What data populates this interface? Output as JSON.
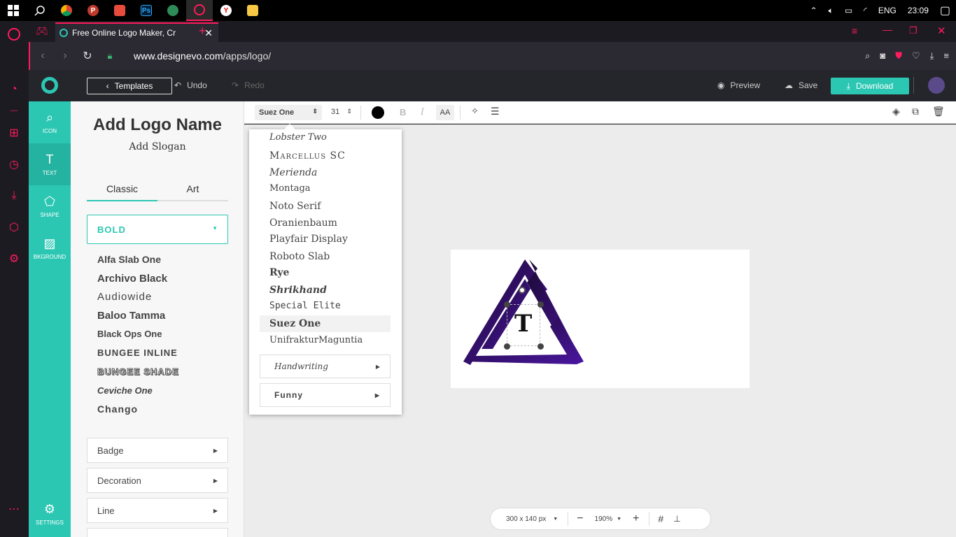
{
  "taskbar": {
    "apps": [
      "chrome",
      "app-p",
      "app-bird",
      "photoshop",
      "app-tree",
      "opera",
      "yandex",
      "explorer"
    ],
    "lang": "ENG",
    "time": "23:09",
    "app_p_label": "P",
    "ps_label": "Ps",
    "yandex_label": "Y"
  },
  "browser": {
    "tab_title": "Free Online Logo Maker, Cr",
    "url_host": "www.designevo.com",
    "url_path": "/apps/logo/",
    "new_tab": "+"
  },
  "header": {
    "templates": "Templates",
    "undo": "Undo",
    "redo": "Redo",
    "preview": "Preview",
    "save": "Save",
    "download": "Download"
  },
  "rail": {
    "icon": "ICON",
    "text": "TEXT",
    "shape": "SHAPE",
    "background": "BKGROUND",
    "settings": "SETTINGS"
  },
  "panel": {
    "title": "Add Logo Name",
    "slogan": "Add Slogan",
    "tabs": [
      "Classic",
      "Art"
    ],
    "category": "BOLD",
    "fonts": [
      "Alfa Slab One",
      "Archivo Black",
      "Audiowide",
      "Baloo Tamma",
      "Black Ops One",
      "BUNGEE INLINE",
      "BUNGEE SHADE",
      "Ceviche One",
      "Chango"
    ],
    "sections": [
      "Badge",
      "Decoration",
      "Line"
    ]
  },
  "toolbar": {
    "font": "Suez One",
    "size": "31",
    "bold": "B",
    "italic": "I",
    "case": "AA"
  },
  "font_dropdown": {
    "items": [
      "Lobster Two",
      "Marcellus SC",
      "Merienda",
      "Montaga",
      "Noto Serif",
      "Oranienbaum",
      "Playfair Display",
      "Roboto Slab",
      "Rye",
      "Shrikhand",
      "Special Elite",
      "Suez One",
      "UnifrakturMaguntia"
    ],
    "selected": "Suez One",
    "submenus": [
      "Handwriting",
      "Funny"
    ]
  },
  "logo": {
    "letter": "T",
    "gradient": [
      "#1b0933",
      "#4a16a0"
    ]
  },
  "bottom": {
    "size": "300 x 140 px",
    "zoom": "190%",
    "minus": "−",
    "plus": "+"
  },
  "colors": {
    "accent": "#2cc7b3",
    "opera": "#ff1b5d"
  }
}
